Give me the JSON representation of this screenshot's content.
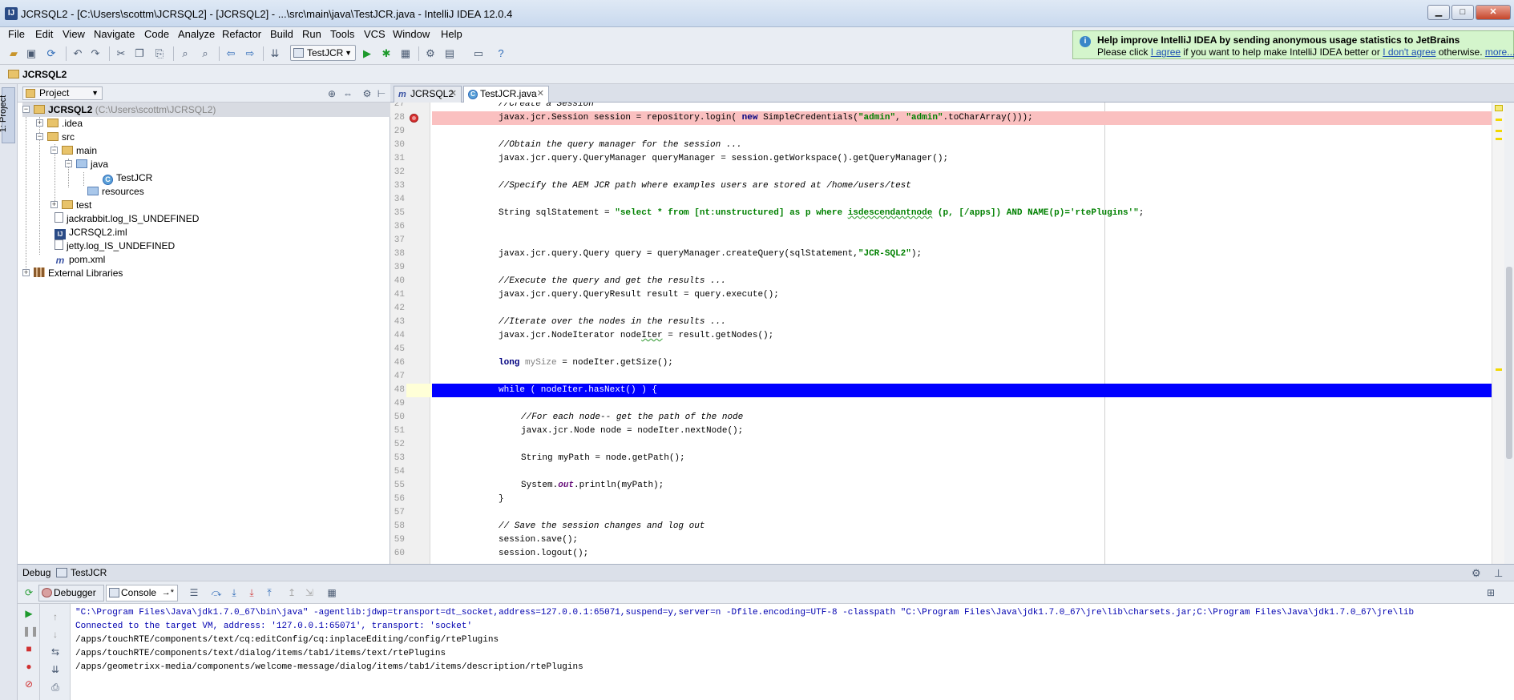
{
  "window": {
    "title": "JCRSQL2 - [C:\\Users\\scottm\\JCRSQL2] - [JCRSQL2] - ...\\src\\main\\java\\TestJCR.java - IntelliJ IDEA 12.0.4",
    "app_icon_label": "IJ",
    "minimize_glyph": "▁",
    "maximize_glyph": "□",
    "close_glyph": "✕"
  },
  "menu": [
    "File",
    "Edit",
    "View",
    "Navigate",
    "Code",
    "Analyze",
    "Refactor",
    "Build",
    "Run",
    "Tools",
    "VCS",
    "Window",
    "Help"
  ],
  "toolbar": {
    "run_config": "TestJCR",
    "icons": [
      "open-folder-icon",
      "save-icon",
      "sync-icon",
      "undo-icon",
      "redo-icon",
      "cut-icon",
      "copy-icon",
      "paste-icon",
      "find-icon",
      "replace-icon",
      "back-icon",
      "forward-icon",
      "make-icon",
      "run-icon",
      "debug-icon",
      "coverage-icon",
      "settings-icon",
      "project-structure-icon",
      "sdk-icon",
      "help-icon"
    ]
  },
  "notification": {
    "heading": "Help improve IntelliJ IDEA by sending anonymous usage statistics to JetBrains",
    "prefix": "Please click ",
    "agree": "I agree",
    "middle": " if you want to help make IntelliJ IDEA better or ",
    "disagree": "I don't agree",
    "suffix": " otherwise. ",
    "more": "more..."
  },
  "navbar": {
    "crumb": "JCRSQL2"
  },
  "left_stripe": {
    "tab": "1: Project"
  },
  "project": {
    "view_selector": "Project",
    "root": {
      "name": "JCRSQL2",
      "path": "(C:\\Users\\scottm\\JCRSQL2)"
    },
    "items": [
      {
        "name": ".idea"
      },
      {
        "name": "src"
      },
      {
        "name": "main"
      },
      {
        "name": "java"
      },
      {
        "name": "TestJCR"
      },
      {
        "name": "resources"
      },
      {
        "name": "test"
      },
      {
        "name": "jackrabbit.log_IS_UNDEFINED"
      },
      {
        "name": "JCRSQL2.iml"
      },
      {
        "name": "jetty.log_IS_UNDEFINED"
      },
      {
        "name": "pom.xml"
      },
      {
        "name": "External Libraries"
      }
    ]
  },
  "tabs": [
    {
      "label": "JCRSQL2",
      "active": false
    },
    {
      "label": "TestJCR.java",
      "active": true
    }
  ],
  "editor": {
    "lines": [
      {
        "n": "27"
      },
      {
        "n": "28"
      },
      {
        "n": "29"
      },
      {
        "n": "30"
      },
      {
        "n": "31"
      },
      {
        "n": "32"
      },
      {
        "n": "33"
      },
      {
        "n": "34"
      },
      {
        "n": "35"
      },
      {
        "n": "36"
      },
      {
        "n": "37"
      },
      {
        "n": "38"
      },
      {
        "n": "39"
      },
      {
        "n": "40"
      },
      {
        "n": "41"
      },
      {
        "n": "42"
      },
      {
        "n": "43"
      },
      {
        "n": "44"
      },
      {
        "n": "45"
      },
      {
        "n": "46"
      },
      {
        "n": "47"
      },
      {
        "n": "48"
      },
      {
        "n": "49"
      },
      {
        "n": "50"
      },
      {
        "n": "51"
      },
      {
        "n": "52"
      },
      {
        "n": "53"
      },
      {
        "n": "54"
      },
      {
        "n": "55"
      },
      {
        "n": "56"
      },
      {
        "n": "57"
      },
      {
        "n": "58"
      },
      {
        "n": "59"
      },
      {
        "n": "60"
      }
    ],
    "code": {
      "l27": "//Create a Session",
      "l28a": "javax.jcr.Session session = repository.login( ",
      "l28kw": "new",
      "l28b": " SimpleCredentials(",
      "l28s1": "\"admin\"",
      "l28c": ", ",
      "l28s2": "\"admin\"",
      "l28d": ".toCharArray()));",
      "l30": "//Obtain the query manager for the session ...",
      "l31": "javax.jcr.query.QueryManager queryManager = session.getWorkspace().getQueryManager();",
      "l33": "//Specify the AEM JCR path where examples users are stored at /home/users/test",
      "l35a": "String sqlStatement = ",
      "l35s1": "\"select * from [nt:unstructured] as p where ",
      "l35s2": "isdescendantnode",
      "l35s3": " (p, [/apps]) AND NAME(p)='rtePlugins'\"",
      "l35b": ";",
      "l38a": "javax.jcr.query.Query query = queryManager.createQuery(sqlStatement,",
      "l38s": "\"JCR-SQL2\"",
      "l38b": ");",
      "l40": "//Execute the query and get the results ...",
      "l41": "javax.jcr.query.QueryResult result = query.execute();",
      "l43": "//Iterate over the nodes in the results ...",
      "l44a": "javax.jcr.NodeIterator node",
      "l44b": "Iter",
      "l44c": " = result.getNodes();",
      "l46kw": "long",
      "l46u": " mySize",
      "l46b": " = nodeIter.getSize();",
      "l48": "while ( nodeIter.hasNext() ) {",
      "l50": "//For each node-- get the path of the node",
      "l51": "javax.jcr.Node node = nodeIter.nextNode();",
      "l53": "String myPath = node.getPath();",
      "l55a": "System.",
      "l55f": "out",
      "l55b": ".println(myPath);",
      "l56": "}",
      "l58": "// Save the session changes and log out",
      "l59": "session.save();",
      "l60": "session.logout();"
    }
  },
  "debug": {
    "title": "Debug",
    "config": "TestJCR",
    "tabs": [
      "Debugger",
      "Console"
    ],
    "console_arrow": "→*",
    "console": [
      "\"C:\\Program Files\\Java\\jdk1.7.0_67\\bin\\java\" -agentlib:jdwp=transport=dt_socket,address=127.0.0.1:65071,suspend=y,server=n -Dfile.encoding=UTF-8 -classpath \"C:\\Program Files\\Java\\jdk1.7.0_67\\jre\\lib\\charsets.jar;C:\\Program Files\\Java\\jdk1.7.0_67\\jre\\lib",
      "Connected to the target VM, address: '127.0.0.1:65071', transport: 'socket'",
      "/apps/touchRTE/components/text/cq:editConfig/cq:inplaceEditing/config/rtePlugins",
      "/apps/touchRTE/components/text/dialog/items/tab1/items/text/rtePlugins",
      "/apps/geometrixx-media/components/welcome-message/dialog/items/tab1/items/description/rtePlugins"
    ]
  }
}
